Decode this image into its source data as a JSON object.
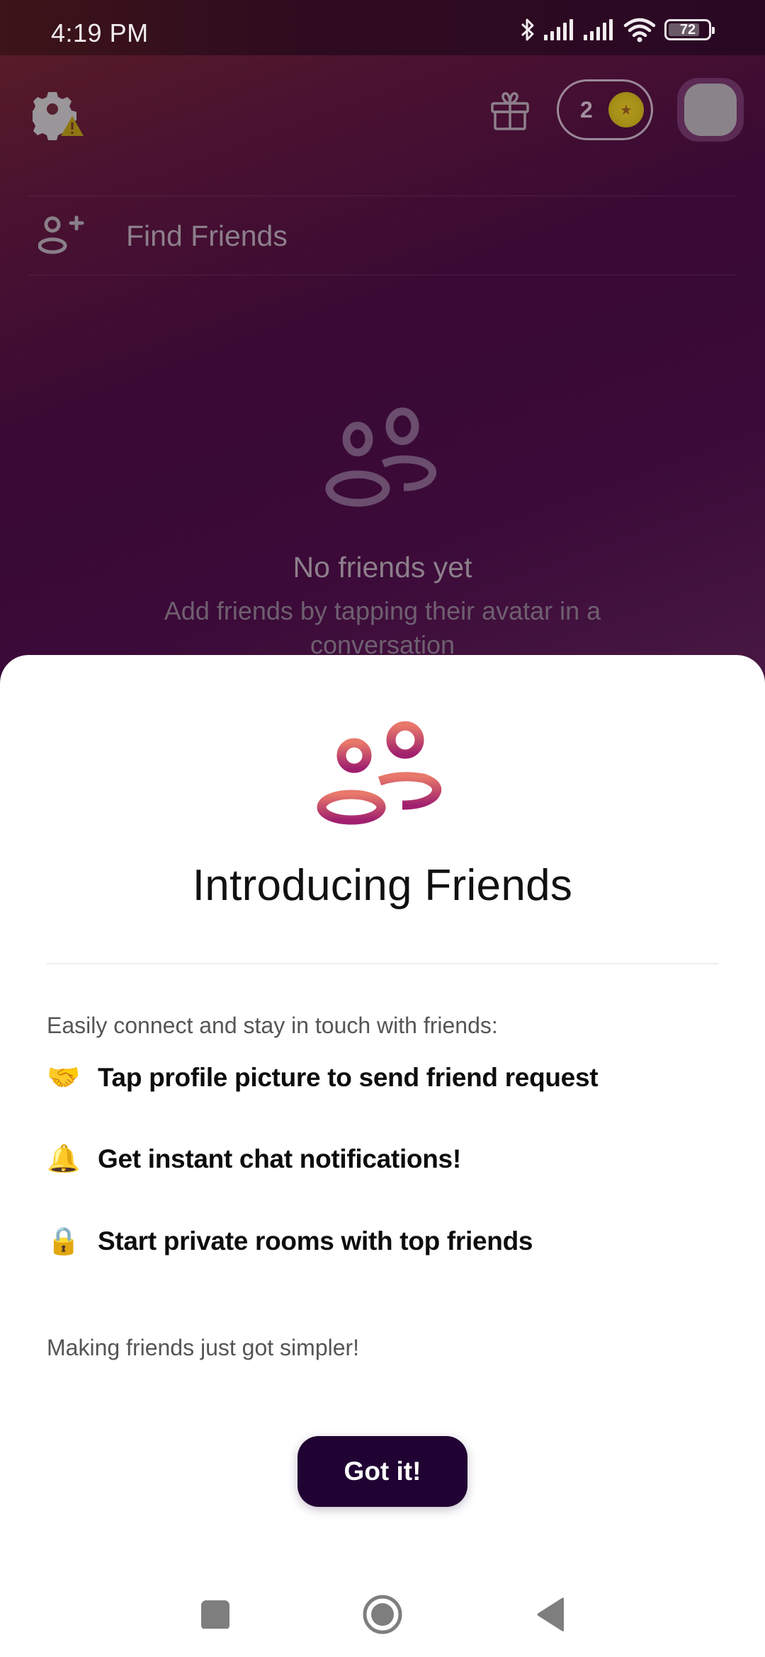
{
  "status_bar": {
    "time": "4:19 PM",
    "battery_level": "72",
    "icons": [
      "bluetooth-icon",
      "signal-icon",
      "signal-icon",
      "wifi-icon",
      "battery-icon"
    ]
  },
  "top_bar": {
    "settings_icon": "gear-icon",
    "warning_badge_icon": "warning-icon",
    "gift_icon": "gift-icon",
    "coin_count": "2",
    "coin_icon": "coin-star-icon"
  },
  "find_friends": {
    "label": "Find Friends",
    "icon": "add-person-icon"
  },
  "empty_state": {
    "icon": "friends-icon",
    "title": "No friends yet",
    "subtitle": "Add friends by tapping their avatar in a conversation"
  },
  "sheet": {
    "icon": "friends-icon",
    "title": "Introducing Friends",
    "intro": "Easily connect and stay in touch with friends:",
    "features": [
      {
        "emoji": "🤝",
        "icon": "handshake-icon",
        "text": "Tap profile picture to send friend request"
      },
      {
        "emoji": "🔔",
        "icon": "bell-icon",
        "text": "Get instant chat notifications!"
      },
      {
        "emoji": "🔒",
        "icon": "lock-icon",
        "text": "Start private rooms with top friends"
      }
    ],
    "outro": "Making friends just got simpler!",
    "button_label": "Got it!",
    "colors": {
      "button_bg": "#200332",
      "icon_gradient_top": "#e8786a",
      "icon_gradient_bottom": "#a0206e"
    }
  },
  "nav_bar": {
    "recents_icon": "square-icon",
    "home_icon": "circle-home-icon",
    "back_icon": "triangle-back-icon"
  }
}
